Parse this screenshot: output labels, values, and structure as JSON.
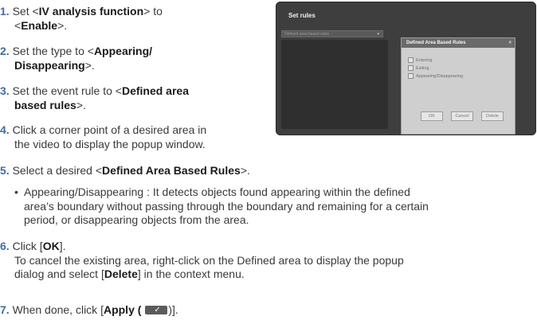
{
  "steps": [
    {
      "num": "1.",
      "parts": [
        [
          "t",
          "Set <"
        ],
        [
          "b",
          "IV analysis function"
        ],
        [
          "t",
          "> to"
        ]
      ],
      "parts2": [
        [
          "t",
          "<"
        ],
        [
          "b",
          "Enable"
        ],
        [
          "t",
          ">."
        ]
      ]
    },
    {
      "num": "2.",
      "parts": [
        [
          "t",
          "Set the type to <"
        ],
        [
          "b",
          "Appearing/"
        ]
      ],
      "parts2": [
        [
          "b",
          "Disappearing"
        ],
        [
          "t",
          ">."
        ]
      ]
    },
    {
      "num": "3.",
      "parts": [
        [
          "t",
          "Set the event rule to <"
        ],
        [
          "b",
          "Defined area"
        ]
      ],
      "parts2": [
        [
          "b",
          "based rules"
        ],
        [
          "t",
          ">."
        ]
      ]
    },
    {
      "num": "4.",
      "line1": "Click a corner point of a desired area in",
      "line2": "the video to display the popup window."
    },
    {
      "num": "5.",
      "parts": [
        [
          "t",
          "Select a desired <"
        ],
        [
          "b",
          "Defined Area Based Rules"
        ],
        [
          "t",
          ">."
        ]
      ]
    },
    {
      "num": "6.",
      "parts": [
        [
          "t",
          "Click ["
        ],
        [
          "b",
          "OK"
        ],
        [
          "t",
          "]."
        ]
      ]
    },
    {
      "num": "7.",
      "pre": "When done, click [",
      "bold": "Apply (",
      "post": ")]."
    }
  ],
  "bullet": {
    "symbol": "•",
    "lines": [
      "Appearing/Disappearing : It detects objects found appearing within the defined",
      "area’s boundary without passing through the boundary and remaining for a certain",
      "period, or disappearing objects from the area."
    ]
  },
  "step6_note": {
    "line1": "To cancel the existing area, right-click on the Defined area to display the popup",
    "pre": "dialog and select [",
    "bold": "Delete",
    "post": "] in the context menu."
  },
  "screenshot": {
    "title": "Set rules",
    "select_value": "Defined area based rules",
    "select_arrow": "▾",
    "dialog_title": "Defined Area Based Rules",
    "dialog_close": "×",
    "options": [
      "Entering",
      "Exiting",
      "Appearing/Disappearing"
    ],
    "buttons": [
      "OK",
      "Cancel",
      "Delete"
    ]
  },
  "apply_check": "✓",
  "colors": {
    "step_number": "#3a6bb5",
    "text": "#3a3a3a"
  }
}
